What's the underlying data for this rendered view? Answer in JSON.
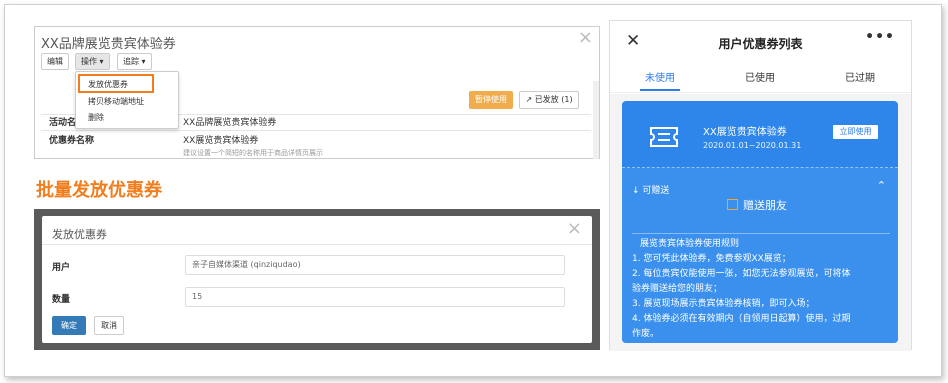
{
  "admin": {
    "title": "XX品牌展览贵宾体验券",
    "toolbar": {
      "edit": "编辑",
      "ops": "操作 ▾",
      "more": "追踪 ▾"
    },
    "menu": [
      "发放优惠券",
      "拷贝移动端地址",
      "删除"
    ],
    "pause_btn": "暂停使用",
    "sent_btn": "已发放 (1)",
    "rows": [
      {
        "label": "活动名",
        "value": "XX品牌展览贵宾体验券"
      },
      {
        "label": "优惠券名称",
        "value": "XX展览贵宾体验券",
        "hint": "建议设置一个简短的名称用于商品详情页展示"
      }
    ]
  },
  "section_heading": "批量发放优惠券",
  "modal": {
    "title": "发放优惠券",
    "user_label": "用户",
    "user_value": "亲子自媒体渠道 (qinziqudao)",
    "qty_label": "数量",
    "qty_value": "15",
    "ok": "确定",
    "cancel": "取消"
  },
  "phone": {
    "title": "用户优惠券列表",
    "tabs": [
      "未使用",
      "已使用",
      "已过期"
    ],
    "coupon": {
      "name": "XX展览贵宾体验券",
      "date": "2020.01.01~2020.01.31",
      "use": "立即使用",
      "giftable": "↓ 可赠送",
      "share": "赠送朋友",
      "rules": [
        "展览贵宾体验券使用规则",
        "1. 您可凭此体验券，免费参观XX展览；",
        "2. 每位贵宾仅能使用一张，如您无法参观展览，可将体",
        "验券赠送给您的朋友；",
        "3. 展览现场展示贵宾体验券核销，即可入场；",
        "4. 体验券必须在有效期内（自领用日起算）使用，过期",
        "作废。"
      ]
    },
    "colors": {
      "accent": "#2e86ea",
      "orange": "#f07e1e"
    }
  }
}
